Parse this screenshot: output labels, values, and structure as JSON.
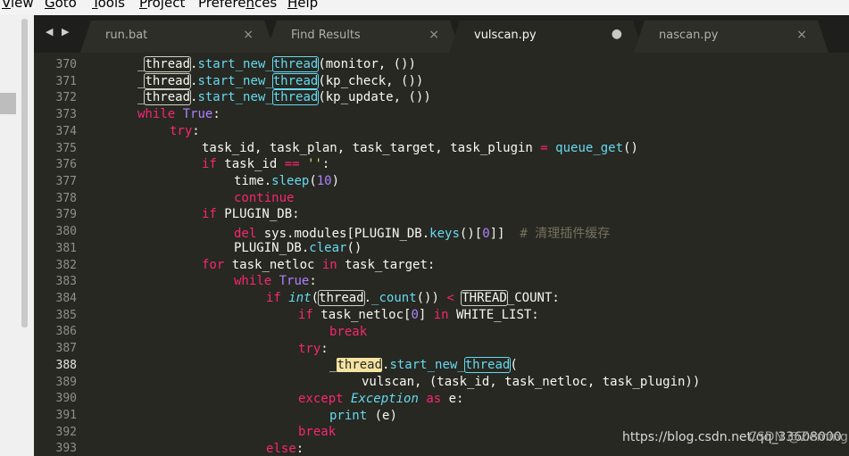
{
  "menu": {
    "items": [
      {
        "label": "View",
        "u": "V",
        "rest": "iew"
      },
      {
        "label": "Goto",
        "u": "G",
        "rest": "oto"
      },
      {
        "label": "Tools",
        "u": "T",
        "rest": "ools"
      },
      {
        "label": "Project",
        "u": "P",
        "rest": "roject"
      },
      {
        "label": "Preferences",
        "u": "n",
        "rest": "Prefere|ces"
      },
      {
        "label": "Help",
        "u": "H",
        "rest": "elp"
      }
    ]
  },
  "tabs": [
    {
      "label": "run.bat",
      "close": "×",
      "active": false
    },
    {
      "label": "Find Results",
      "close": "×",
      "active": false
    },
    {
      "label": "vulscan.py",
      "close": "●",
      "active": true
    },
    {
      "label": "nascan.py",
      "close": "×",
      "active": false
    }
  ],
  "nav_arrows": "◀ ▶",
  "gutter": {
    "lines": [
      "370",
      "371",
      "372",
      "373",
      "374",
      "375",
      "376",
      "377",
      "378",
      "379",
      "380",
      "381",
      "382",
      "383",
      "384",
      "385",
      "386",
      "387",
      "388",
      "389",
      "390",
      "391",
      "392",
      "393"
    ],
    "current": "388"
  },
  "code": {
    "l370": {
      "a": "_",
      "b": "thread",
      "c": ".",
      "d": "start_new_",
      "e": "thread",
      "f": "(monitor, ())"
    },
    "l371": {
      "a": "_",
      "b": "thread",
      "c": ".",
      "d": "start_new_",
      "e": "thread",
      "f": "(kp_check, ())"
    },
    "l372": {
      "a": "_",
      "b": "thread",
      "c": ".",
      "d": "start_new_",
      "e": "thread",
      "f": "(kp_update, ())"
    },
    "l373": {
      "kw": "while",
      "sp": " ",
      "k2": "True",
      "r": ":"
    },
    "l374": {
      "kw": "try",
      "r": ":"
    },
    "l375": {
      "a": "task_id, task_plan, task_target, task_plugin ",
      "op": "=",
      "sp": " ",
      "fn": "queue_get",
      "r": "()"
    },
    "l376": {
      "kw": "if",
      "a": " task_id ",
      "op": "==",
      "sp": " ",
      "str": "''",
      "r": ":"
    },
    "l377": {
      "a": "time.",
      "fn": "sleep",
      "p": "(",
      "num": "10",
      "r": ")"
    },
    "l378": {
      "kw": "continue"
    },
    "l379": {
      "kw": "if",
      "r": " PLUGIN_DB:"
    },
    "l380": {
      "kw": "del",
      "a": " sys.modules[PLUGIN_DB.",
      "fn": "keys",
      "b": "()[",
      "num": "0",
      "c": "]]  ",
      "com": "# 清理插件缓存"
    },
    "l381": {
      "a": "PLUGIN_DB.",
      "fn": "clear",
      "r": "()"
    },
    "l382": {
      "kw": "for",
      "a": " task_netloc ",
      "k2": "in",
      "r": " task_target:"
    },
    "l383": {
      "kw": "while",
      "sp": " ",
      "k2": "True",
      "r": ":"
    },
    "l384": {
      "kw": "if",
      "sp": " ",
      "it": "int",
      "p": "(",
      "box": "thread",
      "a": ".",
      "fn": "_count",
      "b": "()) ",
      "op": "<",
      "sp2": " ",
      "box2": "THREAD",
      "r": "_COUNT:"
    },
    "l385": {
      "kw": "if",
      "a": " task_netloc[",
      "num": "0",
      "b": "] ",
      "k2": "in",
      "r": " WHITE_LIST:"
    },
    "l386": {
      "kw": "break"
    },
    "l387": {
      "kw": "try",
      "r": ":"
    },
    "l388": {
      "a": "_",
      "b": "thread",
      "c": ".",
      "d": "start_new_",
      "e": "thread",
      "f": "("
    },
    "l389": {
      "a": "vulscan, (task_id, task_netloc, task_plugin))"
    },
    "l390": {
      "kw": "except",
      "sp": " ",
      "it": "Exception",
      "sp2": " ",
      "k2": "as",
      "r": " e:"
    },
    "l391": {
      "fn": "print",
      "r": " (e)"
    },
    "l392": {
      "kw": "break"
    },
    "l393": {
      "kw": "else",
      "r": ":"
    }
  },
  "watermark": "https://blog.csdn.net/qq_33608000",
  "overlap_text": "CSDN @Zemingblue",
  "colors": {
    "background": "#272822",
    "keyword": "#f92672",
    "function": "#66d9ef",
    "number": "#ae81ff",
    "comment": "#75715e"
  }
}
